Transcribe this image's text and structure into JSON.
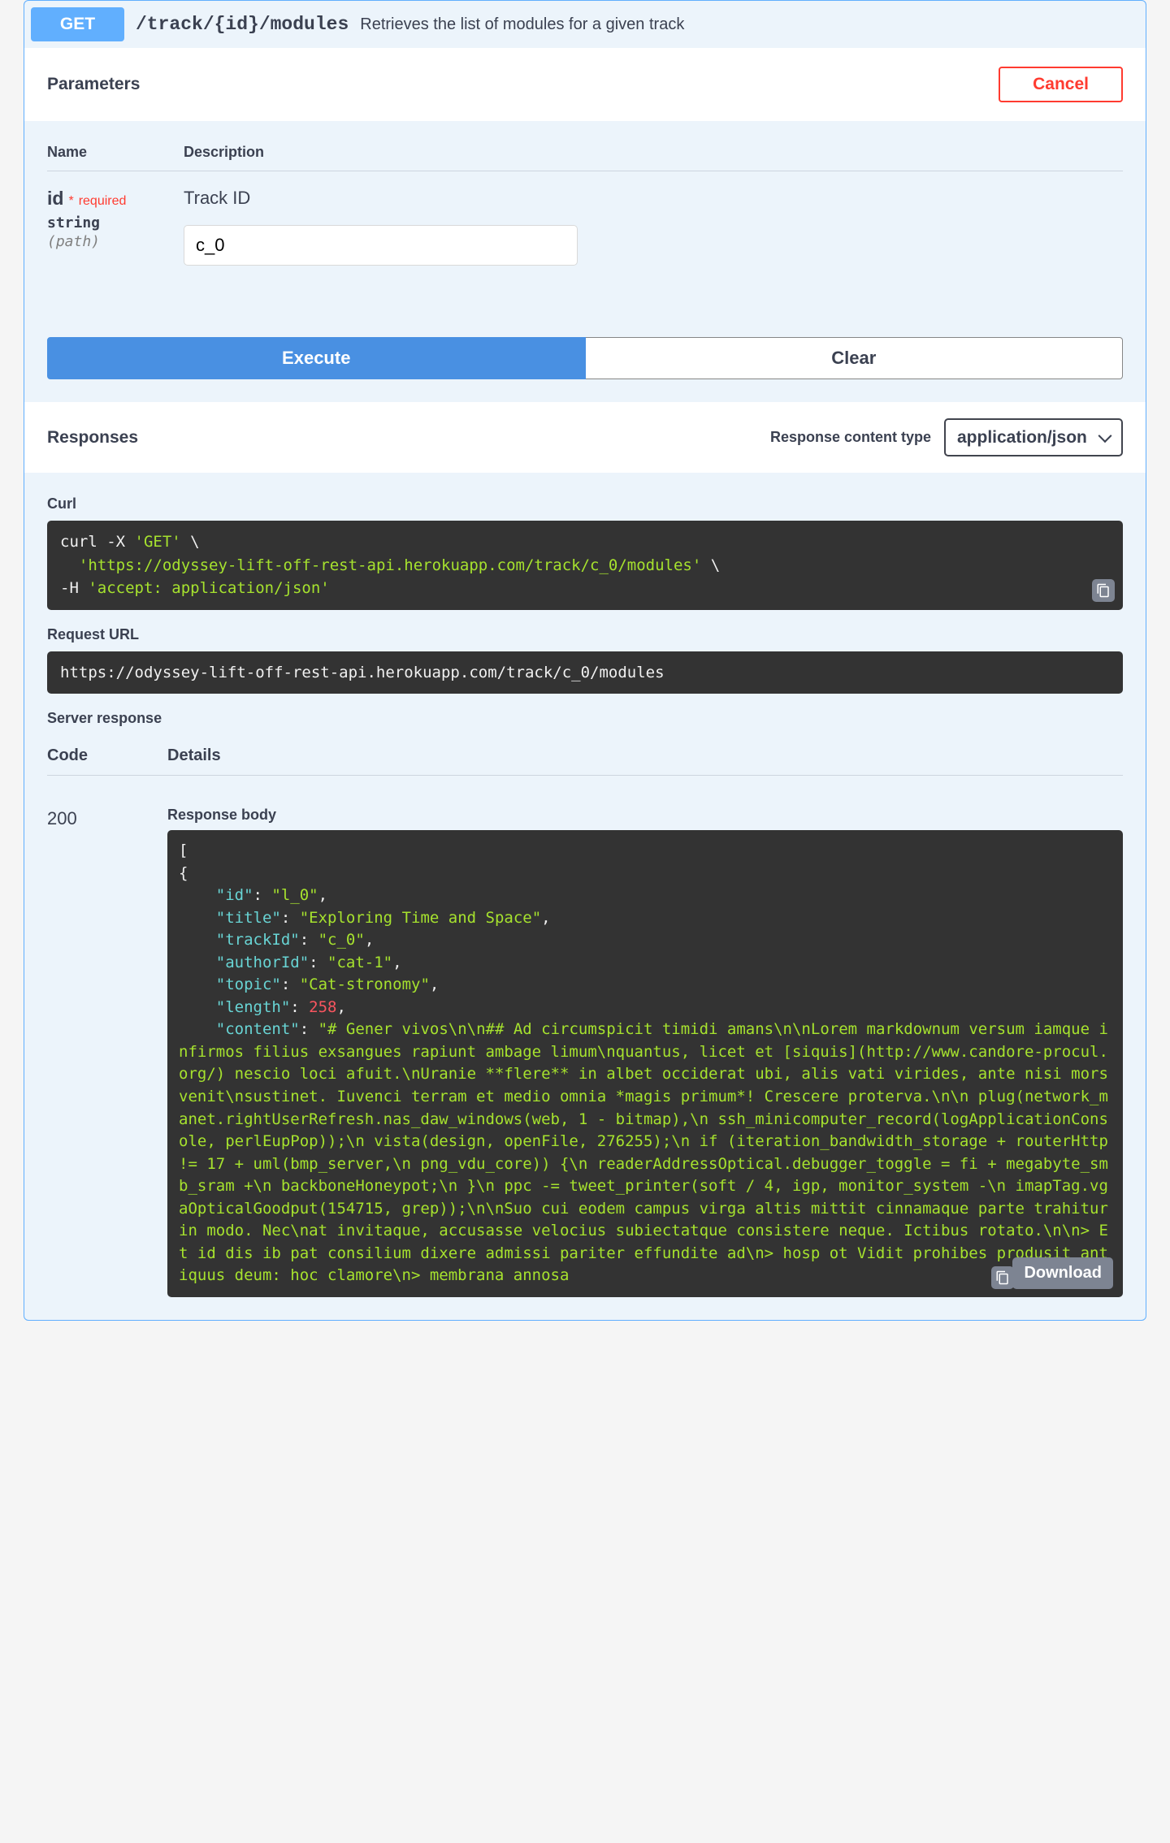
{
  "endpoint": {
    "method": "GET",
    "path": "/track/{id}/modules",
    "summary": "Retrieves the list of modules for a given track"
  },
  "parameters": {
    "title": "Parameters",
    "cancel": "Cancel",
    "columns": {
      "name": "Name",
      "description": "Description"
    },
    "items": [
      {
        "name": "id",
        "required_star": "*",
        "required_label": "required",
        "type": "string",
        "in": "(path)",
        "description": "Track ID",
        "value": "c_0"
      }
    ],
    "execute": "Execute",
    "clear": "Clear"
  },
  "responses": {
    "title": "Responses",
    "content_type_label": "Response content type",
    "content_type_value": "application/json",
    "curl_label": "Curl",
    "curl": {
      "pre1": "curl -X ",
      "method": "'GET'",
      "bs": " \\",
      "url": "'https://odyssey-lift-off-rest-api.herokuapp.com/track/c_0/modules'",
      "bs2": " \\",
      "hflag": "  -H ",
      "header": "'accept: application/json'"
    },
    "request_url_label": "Request URL",
    "request_url": "https://odyssey-lift-off-rest-api.herokuapp.com/track/c_0/modules",
    "server_response_label": "Server response",
    "code_col": "Code",
    "details_col": "Details",
    "code": "200",
    "body_label": "Response body",
    "download": "Download",
    "body_json": {
      "open": "[",
      "brace": "  {",
      "id_k": "\"id\"",
      "id_v": "\"l_0\"",
      "title_k": "\"title\"",
      "title_v": "\"Exploring Time and Space\"",
      "trackId_k": "\"trackId\"",
      "trackId_v": "\"c_0\"",
      "authorId_k": "\"authorId\"",
      "authorId_v": "\"cat-1\"",
      "topic_k": "\"topic\"",
      "topic_v": "\"Cat-stronomy\"",
      "length_k": "\"length\"",
      "length_v": "258",
      "content_k": "\"content\"",
      "content_v": "\"# Gener vivos\\n\\n## Ad circumspicit timidi amans\\n\\nLorem markdownum versum iamque infirmos filius exsangues rapiunt ambage limum\\nquantus, licet et [siquis](http://www.candore-procul.org/) nescio loci afuit.\\nUranie **flere** in albet occiderat ubi, alis vati virides, ante nisi mors venit\\nsustinet. Iuvenci terram et medio omnia *magis primum*! Crescere proterva.\\n\\n    plug(network_manet.rightUserRefresh.nas_daw_windows(web, 1 - bitmap),\\n            ssh_minicomputer_record(logApplicationConsole, perlEupPop));\\n    vista(design, openFile, 276255);\\n    if (iteration_bandwidth_storage + routerHttp != 17 + uml(bmp_server,\\n png_vdu_core)) {\\n        readerAddressOptical.debugger_toggle = fi + megabyte_smb_sram +\\n                backboneHoneypot;\\n    }\\n    ppc -= tweet_printer(soft / 4, igp, monitor_system -\\n            imapTag.vgaOpticalGoodput(154715, grep));\\n\\nSuo cui eodem campus virga altis mittit cinnamaque parte trahitur in modo. Nec\\nat invitaque, accusasse velocius subiectatque consistere neque. Ictibus rotato.\\n\\n> Et id dis    ib    pat consilium dixere admissi pariter effundite ad\\n> hosp    ot        Vidit prohibes produsit  antiquus deum: hoc clamore\\n> membrana annosa"
    }
  }
}
